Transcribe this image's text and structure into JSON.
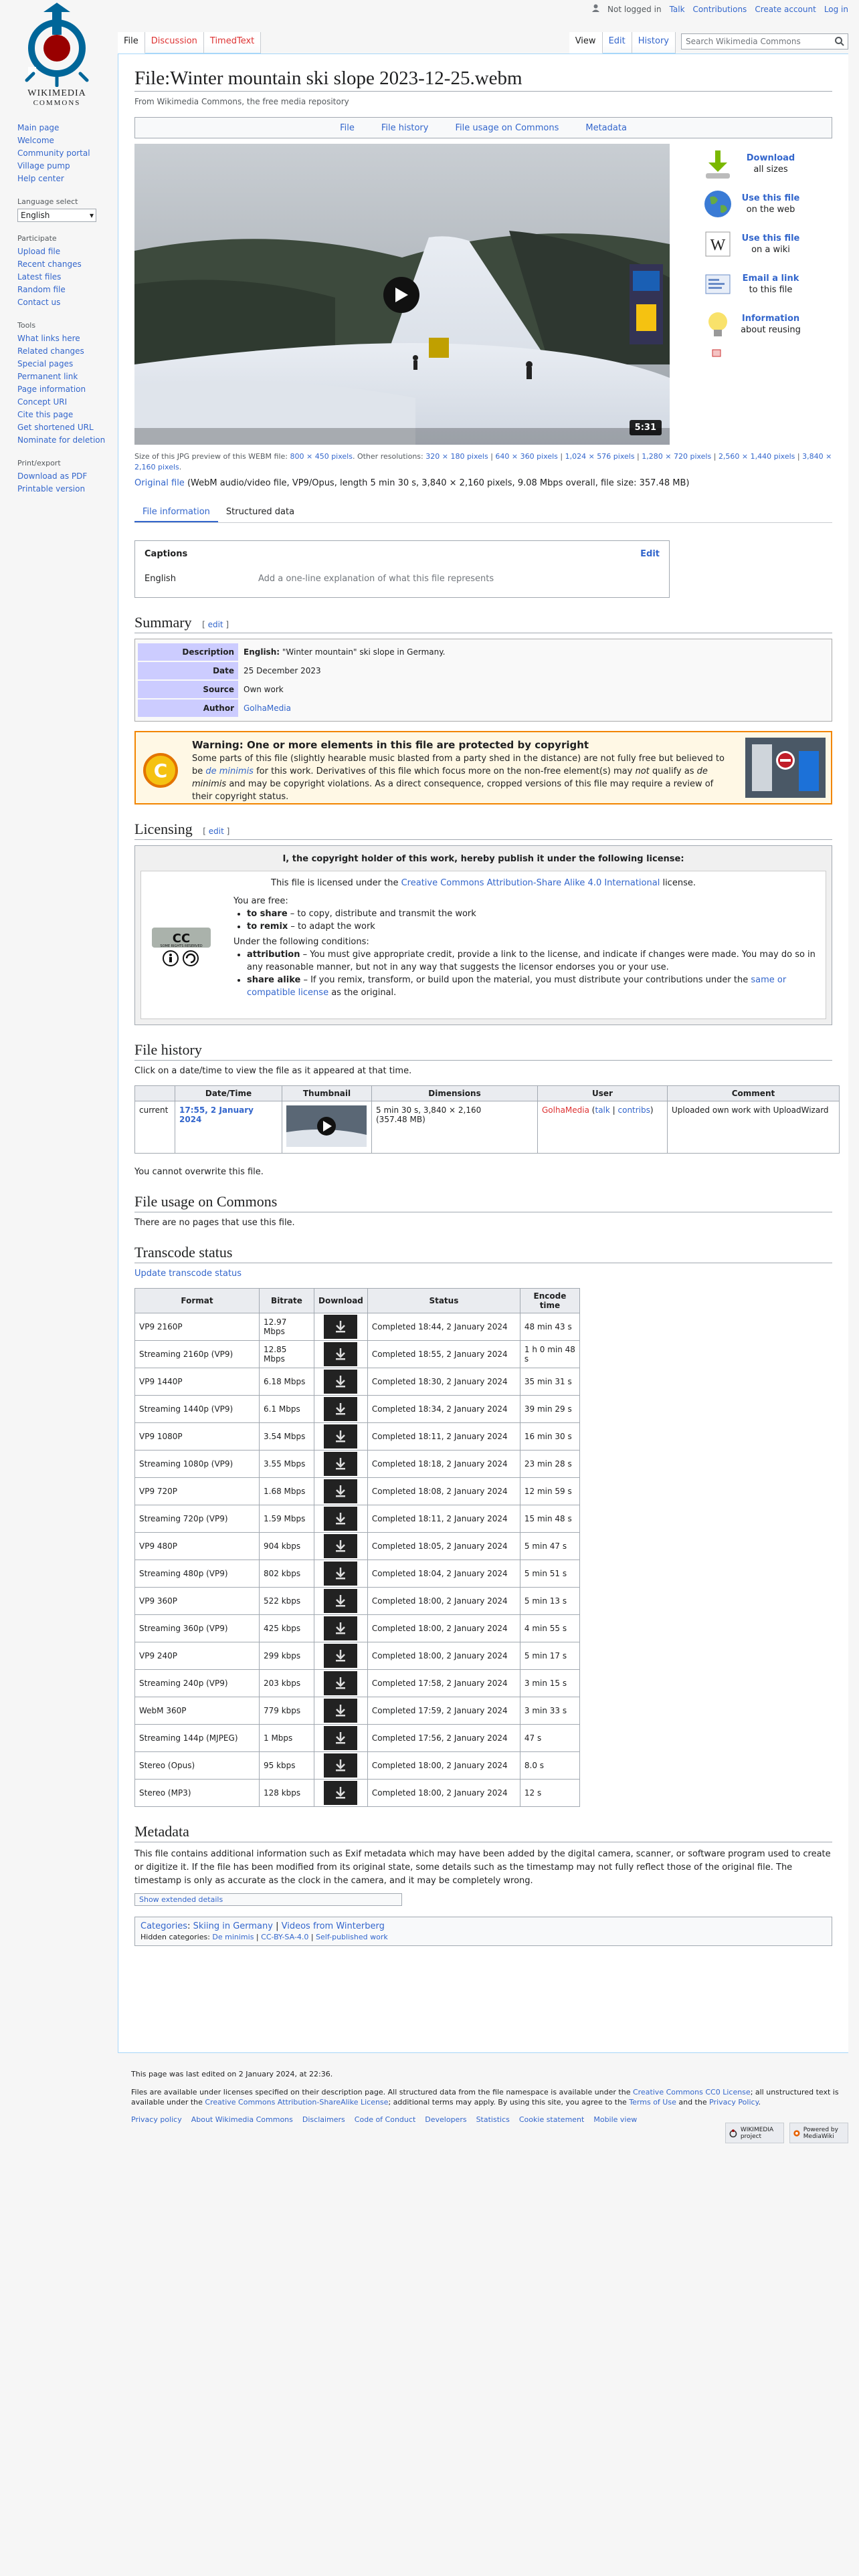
{
  "personal": {
    "not_logged_in": "Not logged in",
    "talk": "Talk",
    "contributions": "Contributions",
    "create_account": "Create account",
    "log_in": "Log in"
  },
  "logo": {
    "line1": "WIKIMEDIA",
    "line2": "COMMONS"
  },
  "tabs": {
    "file": "File",
    "discussion": "Discussion",
    "timedtext": "TimedText",
    "view": "View",
    "edit": "Edit",
    "history": "History"
  },
  "search": {
    "placeholder": "Search Wikimedia Commons"
  },
  "sidebar": {
    "nav": [
      "Main page",
      "Welcome",
      "Community portal",
      "Village pump",
      "Help center"
    ],
    "language_heading": "Language select",
    "language_value": "English",
    "participate_heading": "Participate",
    "participate": [
      "Upload file",
      "Recent changes",
      "Latest files",
      "Random file",
      "Contact us"
    ],
    "tools_heading": "Tools",
    "tools": [
      "What links here",
      "Related changes",
      "Special pages",
      "Permanent link",
      "Page information",
      "Concept URI",
      "Cite this page",
      "Get shortened URL",
      "Nominate for deletion"
    ],
    "print_heading": "Print/export",
    "print": [
      "Download as PDF",
      "Printable version"
    ]
  },
  "page": {
    "title": "File:Winter mountain ski slope 2023-12-25.webm",
    "site_sub": "From Wikimedia Commons, the free media repository"
  },
  "filetoc": [
    "File",
    "File history",
    "File usage on Commons",
    "Metadata"
  ],
  "video": {
    "duration": "5:31"
  },
  "actions": [
    {
      "title": "Download",
      "sub": "all sizes",
      "icon": "download-icon"
    },
    {
      "title": "Use this file",
      "sub": "on the web",
      "icon": "globe-icon"
    },
    {
      "title": "Use this file",
      "sub": "on a wiki",
      "icon": "wikipedia-w-icon"
    },
    {
      "title": "Email a link",
      "sub": "to this file",
      "icon": "email-icon"
    },
    {
      "title": "Information",
      "sub": "about reusing",
      "icon": "lightbulb-icon"
    }
  ],
  "fileinfo": {
    "preview_prefix": "Size of this JPG preview of this WEBM file:",
    "preview_size": "800 × 450 pixels",
    "other_prefix": ". Other resolutions:",
    "resolutions": [
      "320 × 180 pixels",
      "640 × 360 pixels",
      "1,024 × 576 pixels",
      "1,280 × 720 pixels",
      "2,560 × 1,440 pixels",
      "3,840 × 2,160 pixels"
    ],
    "original_link": "Original file",
    "original_desc": "(WebM audio/video file, VP9/Opus, length 5 min 30 s, 3,840 × 2,160 pixels, 9.08 Mbps overall, file size: 357.48 MB)"
  },
  "subtabs": {
    "file_information": "File information",
    "structured_data": "Structured data"
  },
  "captions": {
    "heading": "Captions",
    "edit": "Edit",
    "lang": "English",
    "placeholder": "Add a one-line explanation of what this file represents"
  },
  "summary": {
    "heading": "Summary",
    "edit": "edit",
    "rows": [
      {
        "label": "Description",
        "value_bold": "English:",
        "value": " \"Winter mountain\" ski slope in Germany."
      },
      {
        "label": "Date",
        "value_bold": "",
        "value": "25 December 2023"
      },
      {
        "label": "Source",
        "value_bold": "",
        "value": "Own work"
      },
      {
        "label": "Author",
        "value_bold": "",
        "value": "GolhaMedia"
      }
    ]
  },
  "warning": {
    "title": "Warning: One or more elements in this file are protected by copyright",
    "body_1": "Some parts of this file (slightly hearable music blasted from a party shed in the distance) are not fully free but believed to be ",
    "de_minimis": "de minimis",
    "body_2": " for this work. Derivatives of this file which focus more on the non-free element(s) may ",
    "not": "not",
    "body_3": " qualify as ",
    "de_minimis_2": "de minimis",
    "body_4": " and may be copyright violations. As a direct consequence, cropped versions of this file may require a review of their copyright status."
  },
  "licensing": {
    "heading": "Licensing",
    "edit": "edit",
    "head": "I, the copyright holder of this work, hereby publish it under the following license:",
    "sub_prefix": "This file is licensed under the ",
    "sub_link": "Creative Commons Attribution-Share Alike 4.0 International",
    "sub_suffix": " license.",
    "free": "You are free:",
    "share_b": "to share",
    "share": " – to copy, distribute and transmit the work",
    "remix_b": "to remix",
    "remix": " – to adapt the work",
    "conditions": "Under the following conditions:",
    "attr_b": "attribution",
    "attr": " – You must give appropriate credit, provide a link to the license, and indicate if changes were made. You may do so in any reasonable manner, but not in any way that suggests the licensor endorses you or your use.",
    "sa_b": "share alike",
    "sa_1": " – If you remix, transform, or build upon the material, you must distribute your contributions under the ",
    "sa_link": "same or compatible license",
    "sa_2": " as the original.",
    "cc_text": "CC",
    "cc_sub": "SOME RIGHTS RESERVED"
  },
  "file_history": {
    "heading": "File history",
    "intro": "Click on a date/time to view the file as it appeared at that time.",
    "columns": [
      "",
      "Date/Time",
      "Thumbnail",
      "Dimensions",
      "User",
      "Comment"
    ],
    "row": {
      "status": "current",
      "datetime": "17:55, 2 January 2024",
      "dims_1": "5 min 30 s, 3,840 × 2,160",
      "dims_2": "(357.48 MB)",
      "user": "GolhaMedia",
      "talk": "talk",
      "contribs": "contribs",
      "comment": "Uploaded own work with UploadWizard"
    },
    "no_overwrite": "You cannot overwrite this file."
  },
  "usage": {
    "heading": "File usage on Commons",
    "text": "There are no pages that use this file."
  },
  "transcode": {
    "heading": "Transcode status",
    "update": "Update transcode status",
    "columns": [
      "Format",
      "Bitrate",
      "Download",
      "Status",
      "Encode time"
    ],
    "rows": [
      {
        "format": "VP9 2160P",
        "bitrate": "12.97 Mbps",
        "status": "Completed 18:44, 2 January 2024",
        "time": "48 min 43 s"
      },
      {
        "format": "Streaming 2160p (VP9)",
        "bitrate": "12.85 Mbps",
        "status": "Completed 18:55, 2 January 2024",
        "time": "1 h 0 min 48 s"
      },
      {
        "format": "VP9 1440P",
        "bitrate": "6.18 Mbps",
        "status": "Completed 18:30, 2 January 2024",
        "time": "35 min 31 s"
      },
      {
        "format": "Streaming 1440p (VP9)",
        "bitrate": "6.1 Mbps",
        "status": "Completed 18:34, 2 January 2024",
        "time": "39 min 29 s"
      },
      {
        "format": "VP9 1080P",
        "bitrate": "3.54 Mbps",
        "status": "Completed 18:11, 2 January 2024",
        "time": "16 min 30 s"
      },
      {
        "format": "Streaming 1080p (VP9)",
        "bitrate": "3.55 Mbps",
        "status": "Completed 18:18, 2 January 2024",
        "time": "23 min 28 s"
      },
      {
        "format": "VP9 720P",
        "bitrate": "1.68 Mbps",
        "status": "Completed 18:08, 2 January 2024",
        "time": "12 min 59 s"
      },
      {
        "format": "Streaming 720p (VP9)",
        "bitrate": "1.59 Mbps",
        "status": "Completed 18:11, 2 January 2024",
        "time": "15 min 48 s"
      },
      {
        "format": "VP9 480P",
        "bitrate": "904 kbps",
        "status": "Completed 18:05, 2 January 2024",
        "time": "5 min 47 s"
      },
      {
        "format": "Streaming 480p (VP9)",
        "bitrate": "802 kbps",
        "status": "Completed 18:04, 2 January 2024",
        "time": "5 min 51 s"
      },
      {
        "format": "VP9 360P",
        "bitrate": "522 kbps",
        "status": "Completed 18:00, 2 January 2024",
        "time": "5 min 13 s"
      },
      {
        "format": "Streaming 360p (VP9)",
        "bitrate": "425 kbps",
        "status": "Completed 18:00, 2 January 2024",
        "time": "4 min 55 s"
      },
      {
        "format": "VP9 240P",
        "bitrate": "299 kbps",
        "status": "Completed 18:00, 2 January 2024",
        "time": "5 min 17 s"
      },
      {
        "format": "Streaming 240p (VP9)",
        "bitrate": "203 kbps",
        "status": "Completed 17:58, 2 January 2024",
        "time": "3 min 15 s"
      },
      {
        "format": "WebM 360P",
        "bitrate": "779 kbps",
        "status": "Completed 17:59, 2 January 2024",
        "time": "3 min 33 s"
      },
      {
        "format": "Streaming 144p (MJPEG)",
        "bitrate": "1 Mbps",
        "status": "Completed 17:56, 2 January 2024",
        "time": "47 s"
      },
      {
        "format": "Stereo (Opus)",
        "bitrate": "95 kbps",
        "status": "Completed 18:00, 2 January 2024",
        "time": "8.0 s"
      },
      {
        "format": "Stereo (MP3)",
        "bitrate": "128 kbps",
        "status": "Completed 18:00, 2 January 2024",
        "time": "12 s"
      }
    ]
  },
  "metadata": {
    "heading": "Metadata",
    "text": "This file contains additional information such as Exif metadata which may have been added by the digital camera, scanner, or software program used to create or digitize it. If the file has been modified from its original state, some details such as the timestamp may not fully reflect those of the original file. The timestamp is only as accurate as the clock in the camera, and it may be completely wrong.",
    "button": "Show extended details"
  },
  "categories": {
    "label": "Categories",
    "items": [
      "Skiing in Germany",
      "Videos from Winterberg"
    ],
    "hidden_label": "Hidden categories",
    "hidden": [
      "De minimis",
      "CC-BY-SA-4.0",
      "Self-published work"
    ]
  },
  "footer": {
    "last_edited": "This page was last edited on 2 January 2024, at 22:36.",
    "lic_1": "Files are available under licenses specified on their description page. All structured data from the file namespace is available under the ",
    "lic_link1": "Creative Commons CC0 License",
    "lic_2": "; all unstructured text is available under the ",
    "lic_link2": "Creative Commons Attribution-ShareAlike License",
    "lic_3": "; additional terms may apply. By using this site, you agree to the ",
    "lic_link3": "Terms of Use",
    "lic_4": " and the ",
    "lic_link4": "Privacy Policy",
    "lic_5": ".",
    "links": [
      "Privacy policy",
      "About Wikimedia Commons",
      "Disclaimers",
      "Code of Conduct",
      "Developers",
      "Statistics",
      "Cookie statement",
      "Mobile view"
    ],
    "badge1": "WIKIMEDIA project",
    "badge2": "Powered by MediaWiki"
  }
}
